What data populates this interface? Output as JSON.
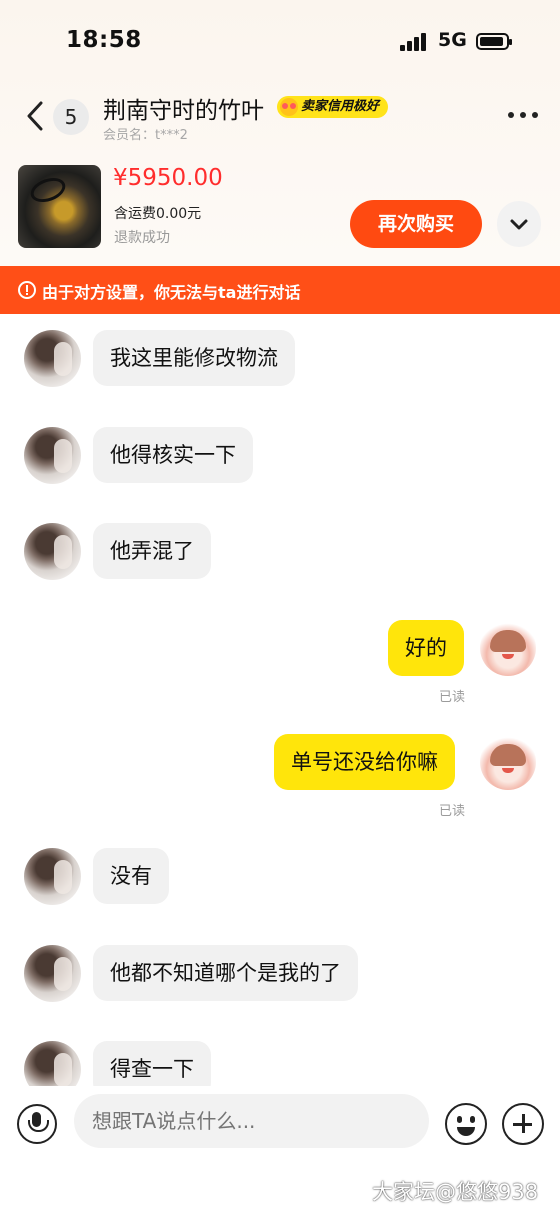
{
  "status_bar": {
    "time": "18:58",
    "network": "5G"
  },
  "header": {
    "unread_count": "5",
    "title": "荆南守时的竹叶",
    "credit_badge": "卖家信用极好",
    "member_label": "会员名：t***2"
  },
  "product": {
    "price": "¥5950.00",
    "shipping": "含运费0.00元",
    "status": "退款成功",
    "buy_again_label": "再次购买"
  },
  "notice": {
    "text": "由于对方设置，你无法与ta进行对话"
  },
  "messages": [
    {
      "side": "left",
      "text": "我这里能修改物流"
    },
    {
      "side": "left",
      "text": "他得核实一下"
    },
    {
      "side": "left",
      "text": "他弄混了"
    },
    {
      "side": "right",
      "text": "好的",
      "status": "已读"
    },
    {
      "side": "right",
      "text": "单号还没给你嘛",
      "status": "已读"
    },
    {
      "side": "left",
      "text": "没有"
    },
    {
      "side": "left",
      "text": "他都不知道哪个是我的了"
    },
    {
      "side": "left",
      "text": "得查一下"
    }
  ],
  "input": {
    "placeholder": "想跟TA说点什么..."
  },
  "watermark": "大家坛@悠悠938",
  "colors": {
    "accent": "#ff4a11",
    "bubble_self": "#ffe50b",
    "price": "#ff2d2d"
  }
}
